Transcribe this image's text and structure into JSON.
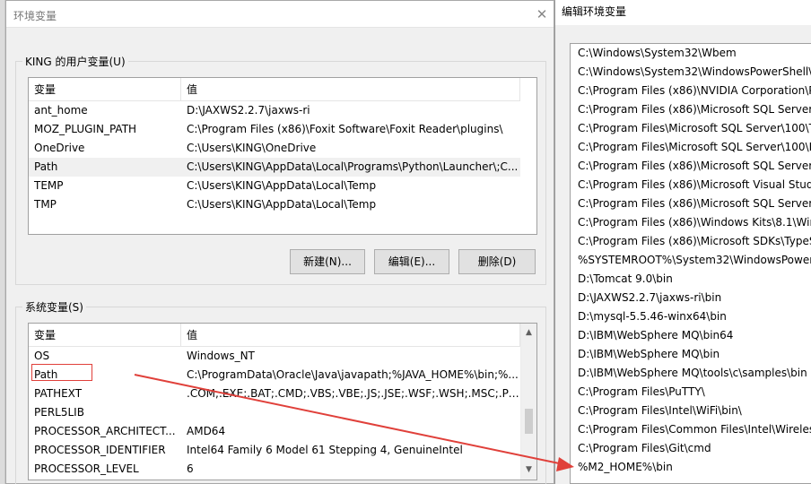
{
  "env_window": {
    "title": "环境变量",
    "user_group_label": "KING 的用户变量(U)",
    "system_group_label": "系统变量(S)",
    "columns": {
      "variable": "变量",
      "value": "值"
    },
    "user_vars": [
      {
        "name": "ant_home",
        "value": "D:\\JAXWS2.2.7\\jaxws-ri"
      },
      {
        "name": "MOZ_PLUGIN_PATH",
        "value": "C:\\Program Files (x86)\\Foxit Software\\Foxit Reader\\plugins\\"
      },
      {
        "name": "OneDrive",
        "value": "C:\\Users\\KING\\OneDrive"
      },
      {
        "name": "Path",
        "value": "C:\\Users\\KING\\AppData\\Local\\Programs\\Python\\Launcher\\;C..."
      },
      {
        "name": "TEMP",
        "value": "C:\\Users\\KING\\AppData\\Local\\Temp"
      },
      {
        "name": "TMP",
        "value": "C:\\Users\\KING\\AppData\\Local\\Temp"
      }
    ],
    "buttons": {
      "new": "新建(N)...",
      "edit": "编辑(E)...",
      "delete": "删除(D)"
    },
    "system_vars": [
      {
        "name": "OS",
        "value": "Windows_NT"
      },
      {
        "name": "Path",
        "value": "C:\\ProgramData\\Oracle\\Java\\javapath;%JAVA_HOME%\\bin;%..."
      },
      {
        "name": "PATHEXT",
        "value": ".COM;.EXE;.BAT;.CMD;.VBS;.VBE;.JS;.JSE;.WSF;.WSH;.MSC;.PY;.P..."
      },
      {
        "name": "PERL5LIB",
        "value": ""
      },
      {
        "name": "PROCESSOR_ARCHITECT...",
        "value": "AMD64"
      },
      {
        "name": "PROCESSOR_IDENTIFIER",
        "value": "Intel64 Family 6 Model 61 Stepping 4, GenuineIntel"
      },
      {
        "name": "PROCESSOR_LEVEL",
        "value": "6"
      }
    ]
  },
  "edit_window": {
    "title": "编辑环境变量",
    "items": [
      "C:\\Windows\\System32\\Wbem",
      "C:\\Windows\\System32\\WindowsPowerShell\\v",
      "C:\\Program Files (x86)\\NVIDIA Corporation\\P",
      "C:\\Program Files (x86)\\Microsoft SQL Server\\",
      "C:\\Program Files\\Microsoft SQL Server\\100\\T",
      "C:\\Program Files\\Microsoft SQL Server\\100\\D",
      "C:\\Program Files (x86)\\Microsoft SQL Server\\",
      "C:\\Program Files (x86)\\Microsoft Visual Studio",
      "C:\\Program Files (x86)\\Microsoft SQL Server\\",
      "C:\\Program Files (x86)\\Windows Kits\\8.1\\Win",
      "C:\\Program Files (x86)\\Microsoft SDKs\\TypeS",
      "%SYSTEMROOT%\\System32\\WindowsPowerSh",
      "D:\\Tomcat 9.0\\bin",
      "D:\\JAXWS2.2.7\\jaxws-ri\\bin",
      "D:\\mysql-5.5.46-winx64\\bin",
      "D:\\IBM\\WebSphere MQ\\bin64",
      "D:\\IBM\\WebSphere MQ\\bin",
      "D:\\IBM\\WebSphere MQ\\tools\\c\\samples\\bin",
      "C:\\Program Files\\PuTTY\\",
      "C:\\Program Files\\Intel\\WiFi\\bin\\",
      "C:\\Program Files\\Common Files\\Intel\\Wireles",
      "C:\\Program Files\\Git\\cmd",
      "%M2_HOME%\\bin"
    ]
  },
  "annotation": {
    "color": "#e0403a"
  }
}
